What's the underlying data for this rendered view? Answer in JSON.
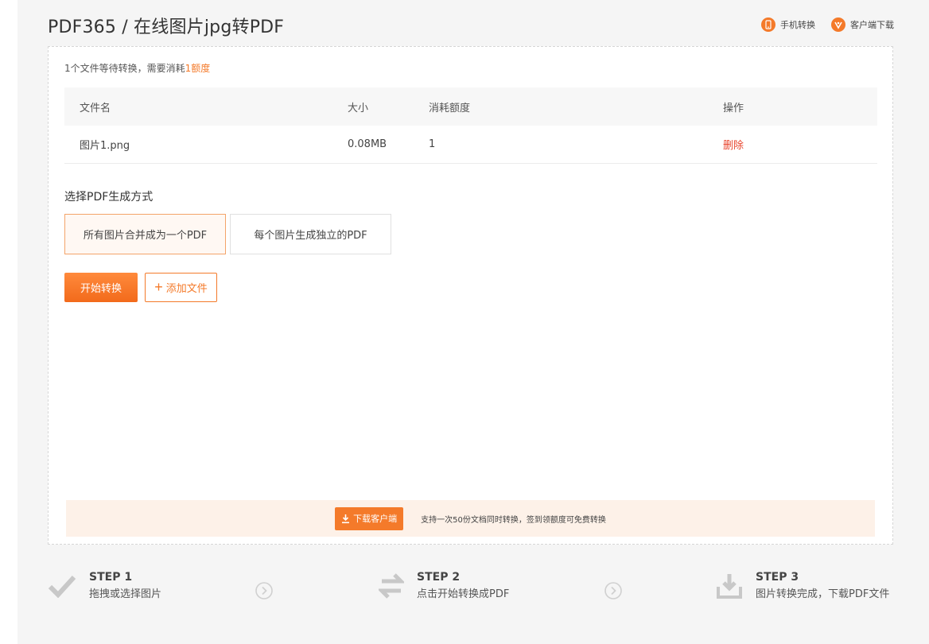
{
  "header": {
    "title": "PDF365 / 在线图片jpg转PDF",
    "mobile_link": "手机转换",
    "client_link": "客户端下载"
  },
  "status": {
    "prefix": "1个文件等待转换，需要消耗",
    "quota": "1额度"
  },
  "table": {
    "headers": [
      "文件名",
      "大小",
      "消耗额度",
      "操作"
    ],
    "rows": [
      {
        "name": "图片1.png",
        "size": "0.08MB",
        "cost": "1",
        "action": "删除"
      }
    ]
  },
  "mode": {
    "title": "选择PDF生成方式",
    "options": [
      "所有图片合并成为一个PDF",
      "每个图片生成独立的PDF"
    ],
    "selected": "所有图片合并成为一个PDF"
  },
  "actions": {
    "start": "开始转换",
    "add": "添加文件"
  },
  "promo": {
    "button": "下载客户端",
    "text": "支持一次50份文档同时转换，签到领额度可免费转换"
  },
  "steps": [
    {
      "label": "STEP 1",
      "desc": "拖拽或选择图片",
      "icon": "check-icon"
    },
    {
      "label": "STEP 2",
      "desc": "点击开始转换成PDF",
      "icon": "convert-arrows-icon"
    },
    {
      "label": "STEP 3",
      "desc": "图片转换完成，下载PDF文件",
      "icon": "download-tray-icon"
    }
  ],
  "colors": {
    "accent": "#f47a2a",
    "danger": "#e8452e",
    "promo_bg": "#fdf1e8",
    "page_bg": "#f5f5f5"
  }
}
